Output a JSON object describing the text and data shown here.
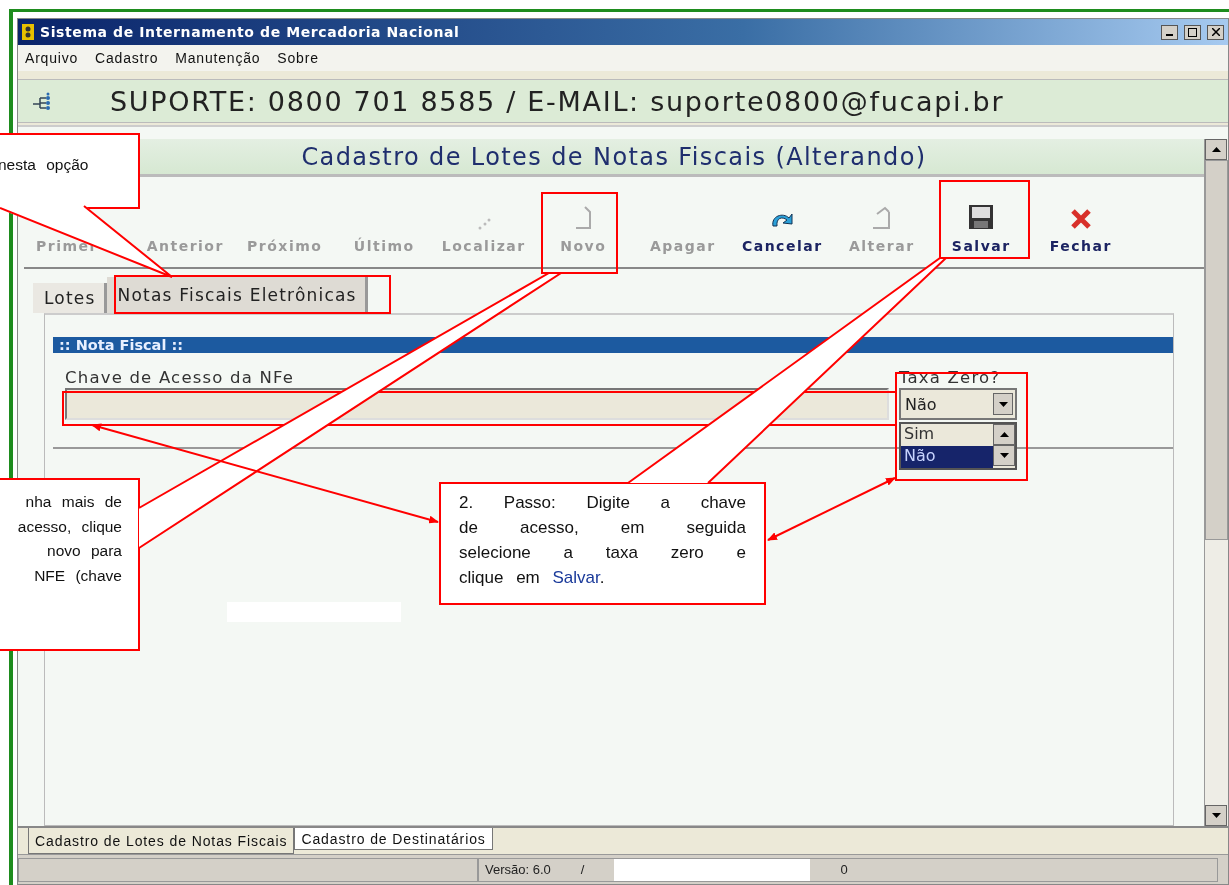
{
  "window": {
    "title": "Sistema de Internamento de Mercadoria Nacional"
  },
  "menu": [
    "Arquivo",
    "Cadastro",
    "Manutenção",
    "Sobre"
  ],
  "support_banner": "SUPORTE: 0800 701 8585 / E-MAIL: suporte0800@fucapi.br",
  "form": {
    "title": "Cadastro de Lotes de Notas Fiscais (Alterando)",
    "toolbar": [
      {
        "label": "Primei",
        "disabled": true
      },
      {
        "label": "Anterior",
        "disabled": true
      },
      {
        "label": "Próximo",
        "disabled": true
      },
      {
        "label": "Último",
        "disabled": true
      },
      {
        "label": "Localizar",
        "disabled": true
      },
      {
        "label": "Novo",
        "disabled": true
      },
      {
        "label": "Apagar",
        "disabled": true
      },
      {
        "label": "Cancelar",
        "disabled": false
      },
      {
        "label": "Alterar",
        "disabled": true
      },
      {
        "label": "Salvar",
        "disabled": false
      },
      {
        "label": "Fechar",
        "disabled": false
      }
    ],
    "tabs": [
      {
        "label": "Lotes",
        "selected": false
      },
      {
        "label": "Notas Fiscais Eletrônicas",
        "selected": true
      }
    ],
    "section": {
      "title": ":: Nota Fiscal ::",
      "key_field": {
        "label": "Chave de Acesso da NFe"
      },
      "taxa_zero": {
        "label": "Taxa Zero?",
        "value": "Não",
        "options": [
          {
            "label": "Sim",
            "selected": false
          },
          {
            "label": "Não",
            "selected": true
          }
        ]
      }
    }
  },
  "bottom_tabs": [
    {
      "label": "Cadastro de Lotes de Notas Fiscais",
      "selected": true
    },
    {
      "label": "Cadastro de Destinatários",
      "selected": false
    }
  ],
  "status_bar": {
    "version": "Versão: 6.0",
    "separator": "/",
    "trailing": "0"
  },
  "callouts": [
    {
      "lines": [
        "nesta opção"
      ]
    },
    {
      "lines": [
        "nha mais de",
        "acesso, clique",
        "novo para",
        "NFE (chave"
      ]
    },
    {
      "lines": [
        "2. Passo: Digite a chave",
        "de acesso, em seguida",
        "selecione a taxa zero e"
      ],
      "last_line": "clique em ",
      "highlight": "Salvar",
      "end": "."
    }
  ]
}
